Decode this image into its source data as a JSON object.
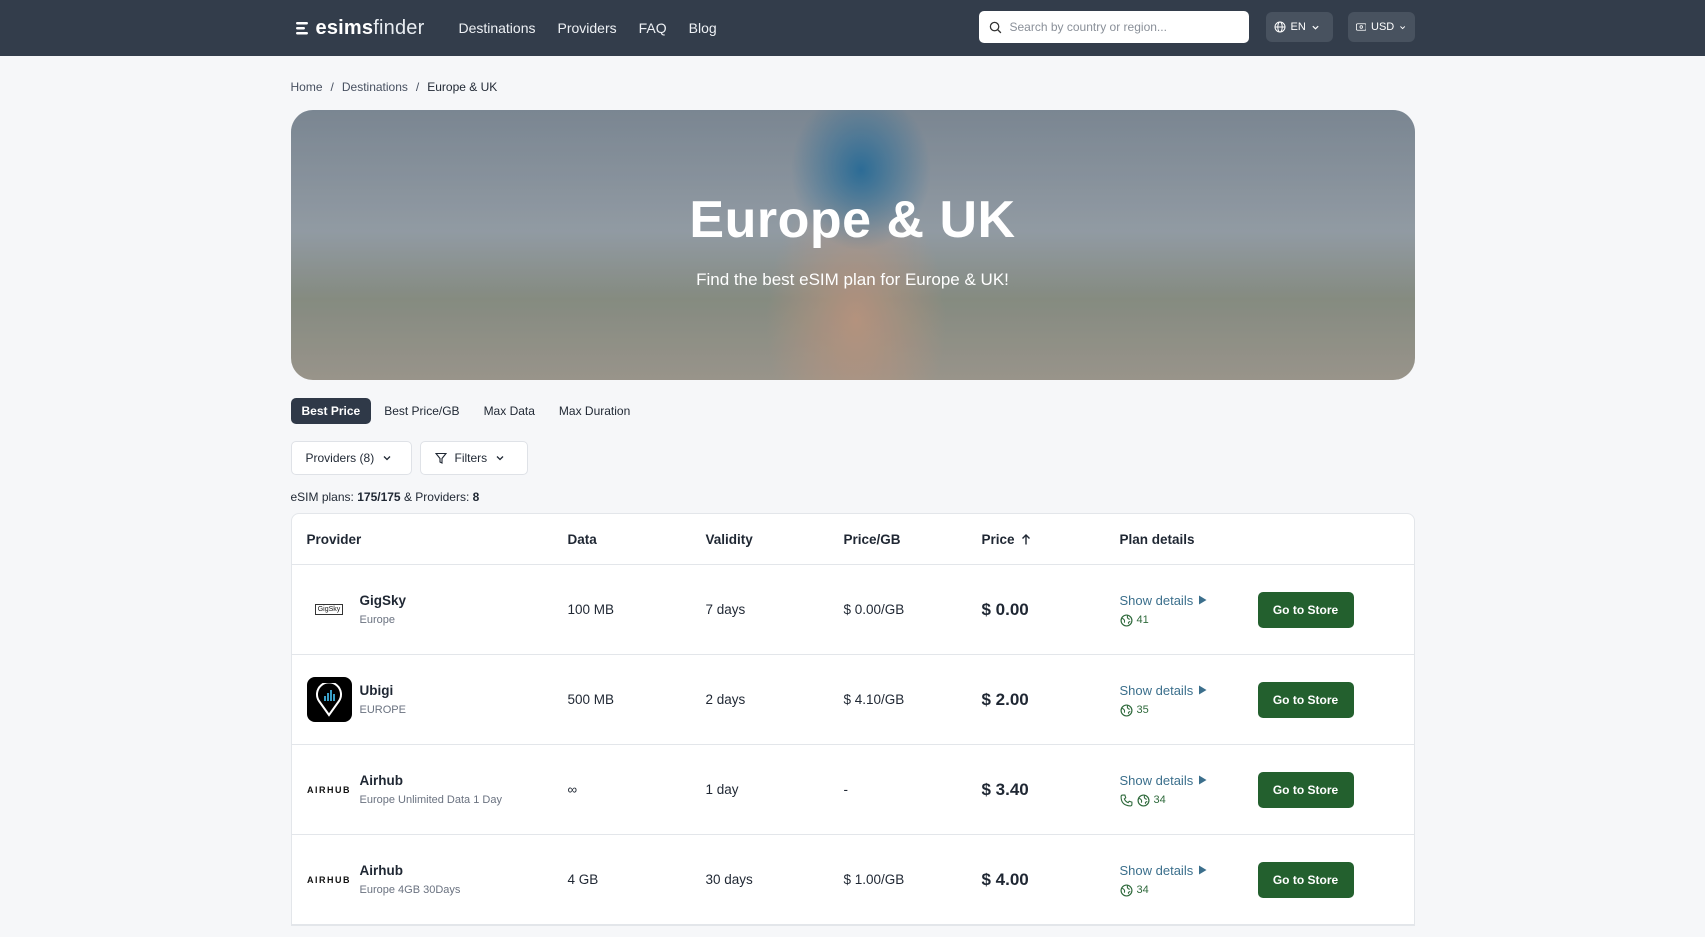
{
  "brand": {
    "name_bold": "esims",
    "name_thin": "finder"
  },
  "nav": {
    "items": [
      "Destinations",
      "Providers",
      "FAQ",
      "Blog"
    ]
  },
  "search": {
    "placeholder": "Search by country or region..."
  },
  "lang": {
    "label": "EN"
  },
  "currency": {
    "label": "USD"
  },
  "breadcrumb": {
    "items": [
      "Home",
      "Destinations",
      "Europe & UK"
    ],
    "separator": "/"
  },
  "hero": {
    "title": "Europe & UK",
    "subtitle": "Find the best eSIM plan for Europe & UK!"
  },
  "sort_tabs": {
    "items": [
      "Best Price",
      "Best Price/GB",
      "Max Data",
      "Max Duration"
    ],
    "active": "Best Price"
  },
  "filters": {
    "providers_label": "Providers (8)",
    "filters_label": "Filters"
  },
  "summary": {
    "plans_prefix": "eSIM plans:",
    "plans_value": "175/175",
    "providers_prefix": "& Providers:",
    "providers_value": "8"
  },
  "table": {
    "headers": {
      "provider": "Provider",
      "data": "Data",
      "validity": "Validity",
      "price_per_gb": "Price/GB",
      "price": "Price",
      "plan_details": "Plan details"
    },
    "show_details": "Show details",
    "store_button": "Go to Store",
    "rows": [
      {
        "name": "GigSky",
        "sub": "Europe",
        "logo": "GigSky",
        "data": "100 MB",
        "validity": "7 days",
        "price_per_gb": "$ 0.00/GB",
        "price": "$ 0.00",
        "countries": "41",
        "has_calls": false
      },
      {
        "name": "Ubigi",
        "sub": "EUROPE",
        "logo": "ubigi-icon",
        "data": "500 MB",
        "validity": "2 days",
        "price_per_gb": "$ 4.10/GB",
        "price": "$ 2.00",
        "countries": "35",
        "has_calls": false
      },
      {
        "name": "Airhub",
        "sub": "Europe Unlimited Data 1 Day",
        "logo": "AIRHUB",
        "data": "∞",
        "validity": "1 day",
        "price_per_gb": "-",
        "price": "$ 3.40",
        "countries": "34",
        "has_calls": true
      },
      {
        "name": "Airhub",
        "sub": "Europe 4GB 30Days",
        "logo": "AIRHUB",
        "data": "4 GB",
        "validity": "30 days",
        "price_per_gb": "$ 1.00/GB",
        "price": "$ 4.00",
        "countries": "34",
        "has_calls": false
      }
    ]
  },
  "colors": {
    "topbar": "#333d4b",
    "store_button": "#23602e",
    "link": "#3b6f8c",
    "active_tab": "#2f3948"
  }
}
